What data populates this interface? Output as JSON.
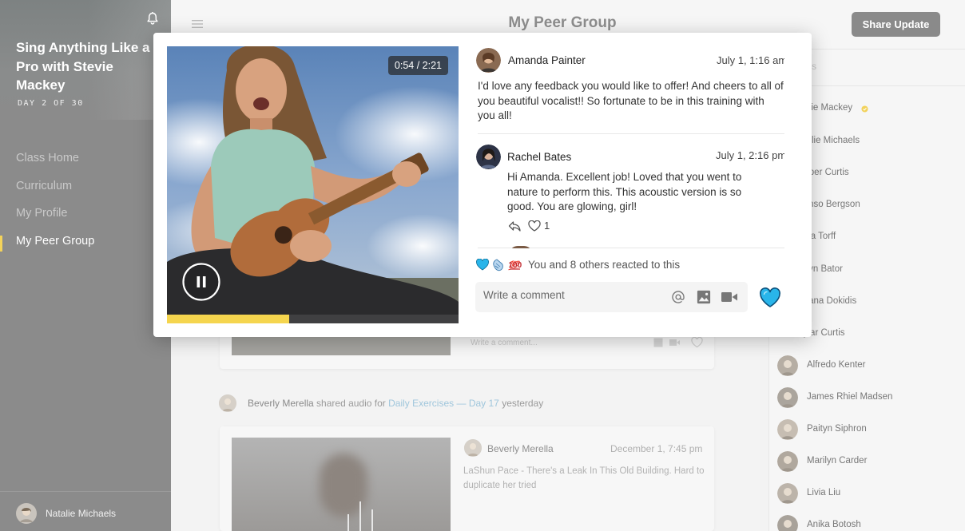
{
  "sidebar": {
    "course_title": "Sing Anything Like a Pro with Stevie Mackey",
    "day_label": "DAY 2 OF 30",
    "nav": [
      "Class Home",
      "Curriculum",
      "My Profile",
      "My Peer Group"
    ],
    "active_nav": "My Peer Group",
    "user_name": "Natalie Michaels"
  },
  "header": {
    "title": "My Peer Group",
    "share_button": "Share Update"
  },
  "background_feed": {
    "card1_comment_placeholder": "Write a comment...",
    "activity": {
      "user": "Beverly Merella",
      "verb": "shared audio for",
      "link": "Daily Exercises — Day 17",
      "when": "yesterday"
    },
    "card2": {
      "author": "Beverly Merella",
      "time": "December 1, 7:45 pm",
      "text": "LaShun Pace - There's a Leak In This Old Building. Hard to duplicate her tried"
    }
  },
  "members": {
    "header_fragment": "rs",
    "list": [
      "Stevie Mackey",
      "Natalie Michaels",
      "Hooper Curtis",
      "Alfonso Bergson",
      "Anika Torff",
      "Paityn Bator",
      "Tatiana Dokidis",
      "Skylar Curtis",
      "Alfredo Kenter",
      "James Rhiel Madsen",
      "Paityn Siphron",
      "Marilyn Carder",
      "Livia Liu",
      "Anika Botosh"
    ],
    "visible_names": [
      "tevie Mackey",
      "atalie Michaels",
      "ooper Curtis",
      "lfonso Bergson",
      "nika Torff",
      "aityn Bator",
      "atiana Dokidis",
      "kylar Curtis",
      "Alfredo Kenter",
      "James Rhiel Madsen",
      "Paityn Siphron",
      "Marilyn Carder",
      "Livia Liu",
      "Anika Botosh"
    ]
  },
  "modal": {
    "video": {
      "timecode": "0:54 / 2:21",
      "progress": 0.42
    },
    "comments": [
      {
        "author": "Amanda Painter",
        "time": "July 1, 1:16 am",
        "text": "I'd love any feedback you would like to offer! And cheers to all of you beautiful vocalist!! So fortunate to be in this training with you all!"
      },
      {
        "author": "Rachel Bates",
        "time": "July 1, 2:16 pm",
        "text": "Hi Amanda. Excellent job! Loved that you went to nature to perform this. This acoustic version is so good. You are glowing, girl!",
        "likes": "1"
      }
    ],
    "reactions_text": "You and 8 others reacted to this",
    "comment_placeholder": "Write a comment"
  },
  "colors": {
    "accent_yellow": "#f5d54e",
    "heart_blue": "#29b5ea",
    "sidebar_gray": "#8b8b8b"
  },
  "icons": [
    "bell-icon",
    "hamburger-icon",
    "pause-icon",
    "reply-icon",
    "heart-outline-icon",
    "blue-heart-emoji",
    "clapping-hands-emoji",
    "hundred-points-emoji",
    "mention-icon",
    "image-icon",
    "video-camera-icon",
    "heart-filled-icon"
  ]
}
